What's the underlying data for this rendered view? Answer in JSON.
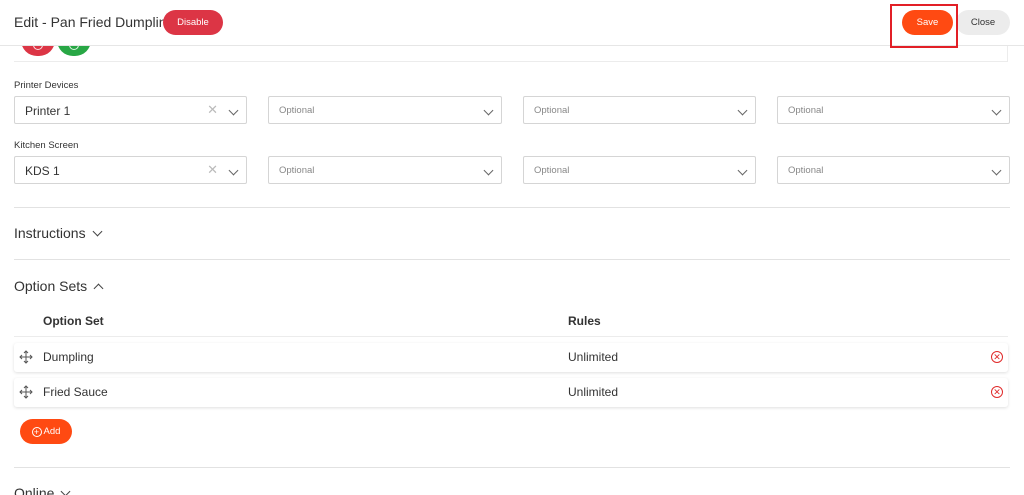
{
  "header": {
    "title": "Edit - Pan Fried Dumpling",
    "disable_label": "Disable",
    "save_label": "Save",
    "close_label": "Close"
  },
  "printer_devices": {
    "label": "Printer Devices",
    "selects": [
      {
        "value": "Printer 1",
        "placeholder": ""
      },
      {
        "value": "",
        "placeholder": "Optional"
      },
      {
        "value": "",
        "placeholder": "Optional"
      },
      {
        "value": "",
        "placeholder": "Optional"
      }
    ]
  },
  "kitchen_screen": {
    "label": "Kitchen Screen",
    "selects": [
      {
        "value": "KDS 1",
        "placeholder": ""
      },
      {
        "value": "",
        "placeholder": "Optional"
      },
      {
        "value": "",
        "placeholder": "Optional"
      },
      {
        "value": "",
        "placeholder": "Optional"
      }
    ]
  },
  "instructions": {
    "title": "Instructions"
  },
  "option_sets": {
    "title": "Option Sets",
    "columns": {
      "option_set": "Option Set",
      "rules": "Rules"
    },
    "rows": [
      {
        "name": "Dumpling",
        "rules": "Unlimited"
      },
      {
        "name": "Fried Sauce",
        "rules": "Unlimited"
      }
    ],
    "add_label": "Add"
  },
  "online": {
    "title": "Online"
  },
  "icons": {
    "clear": "clear-x-icon",
    "dropdown": "chevron-down-icon",
    "drag": "move-handle-icon",
    "remove": "remove-circle-icon",
    "add": "plus-circle-icon"
  },
  "colors": {
    "accent": "#ff4a12",
    "danger": "#dc3545",
    "success": "#28a745",
    "highlight": "#e21f26"
  }
}
